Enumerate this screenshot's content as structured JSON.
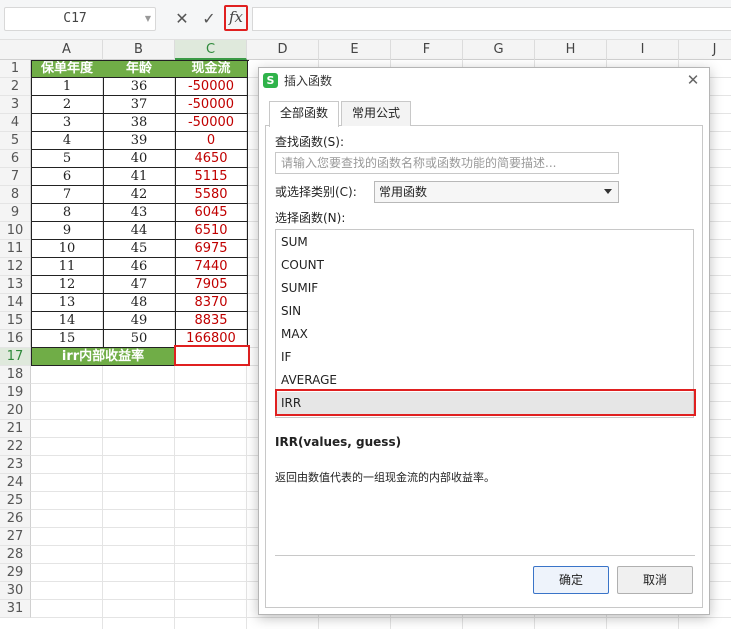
{
  "formula_bar": {
    "cell_ref": "C17",
    "cancel_icon": "close-icon",
    "confirm_icon": "check-icon",
    "fx_label": "fx",
    "formula_value": ""
  },
  "sheet": {
    "column_headers": [
      "A",
      "B",
      "C",
      "D",
      "E",
      "F",
      "G",
      "H",
      "I",
      "J"
    ],
    "active_column": "C",
    "row_headers": [
      "1",
      "2",
      "3",
      "4",
      "5",
      "6",
      "7",
      "8",
      "9",
      "10",
      "11",
      "12",
      "13",
      "14",
      "15",
      "16",
      "17",
      "18",
      "19",
      "20",
      "21",
      "22",
      "23",
      "24",
      "25",
      "26",
      "27",
      "28",
      "29",
      "30",
      "31"
    ],
    "active_row": "17",
    "table_headers": [
      "保单年度",
      "年龄",
      "现金流"
    ],
    "rows": [
      [
        "1",
        "36",
        "-50000"
      ],
      [
        "2",
        "37",
        "-50000"
      ],
      [
        "3",
        "38",
        "-50000"
      ],
      [
        "4",
        "39",
        "0"
      ],
      [
        "5",
        "40",
        "4650"
      ],
      [
        "6",
        "41",
        "5115"
      ],
      [
        "7",
        "42",
        "5580"
      ],
      [
        "8",
        "43",
        "6045"
      ],
      [
        "9",
        "44",
        "6510"
      ],
      [
        "10",
        "45",
        "6975"
      ],
      [
        "11",
        "46",
        "7440"
      ],
      [
        "12",
        "47",
        "7905"
      ],
      [
        "13",
        "48",
        "8370"
      ],
      [
        "14",
        "49",
        "8835"
      ],
      [
        "15",
        "50",
        "166800"
      ]
    ],
    "irr_label": "irr内部收益率",
    "irr_value": "",
    "header_color": "#70ad47",
    "negative_value_color": "#c00000"
  },
  "dialog": {
    "title": "插入函数",
    "logo_text": "S",
    "tabs": [
      {
        "label": "全部函数",
        "active": true
      },
      {
        "label": "常用公式",
        "active": false
      }
    ],
    "search_label": "查找函数(S):",
    "search_placeholder": "请输入您要查找的函数名称或函数功能的简要描述...",
    "category_label": "或选择类别(C):",
    "category_value": "常用函数",
    "functions_label": "选择函数(N):",
    "functions": [
      "SUM",
      "COUNT",
      "SUMIF",
      "SIN",
      "MAX",
      "IF",
      "AVERAGE",
      "IRR"
    ],
    "selected_function": "IRR",
    "signature": "IRR(values, guess)",
    "description": "返回由数值代表的一组现金流的内部收益率。",
    "ok_label": "确定",
    "cancel_label": "取消",
    "highlight_color": "#e02020"
  }
}
